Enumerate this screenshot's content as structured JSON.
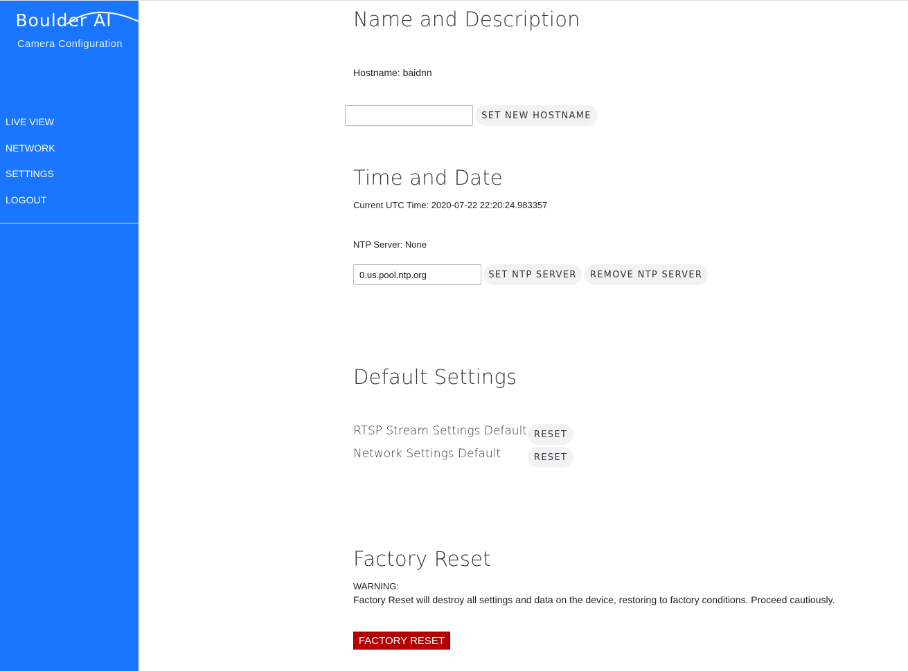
{
  "sidebar": {
    "brand": "Boulder AI",
    "subtitle": "Camera Configuration",
    "items": [
      {
        "label": "LIVE VIEW"
      },
      {
        "label": "NETWORK"
      },
      {
        "label": "SETTINGS"
      },
      {
        "label": "LOGOUT"
      }
    ]
  },
  "name_section": {
    "title": "Name and Description",
    "hostname_text": "Hostname: baidnn",
    "hostname_input_value": "",
    "set_hostname_label": "SET NEW HOSTNAME"
  },
  "time_section": {
    "title": "Time and Date",
    "utc_time_text": "Current UTC Time: 2020-07-22 22:20:24.983357",
    "ntp_server_text": "NTP Server: None",
    "ntp_input_value": "0.us.pool.ntp.org",
    "set_ntp_label": "SET NTP SERVER",
    "remove_ntp_label": "REMOVE NTP SERVER"
  },
  "defaults_section": {
    "title": "Default Settings",
    "rows": [
      {
        "label": "RTSP Stream Settings Default",
        "button": "RESET"
      },
      {
        "label": "Network Settings Default",
        "button": "RESET"
      }
    ]
  },
  "factory_section": {
    "title": "Factory Reset",
    "warning_heading": "WARNING:",
    "warning_text": "Factory Reset will destroy all settings and data on the device, restoring to factory conditions. Proceed cautiously.",
    "button_label": "FACTORY RESET"
  },
  "colors": {
    "sidebar_bg": "#1a75ff",
    "danger": "#b30000"
  }
}
